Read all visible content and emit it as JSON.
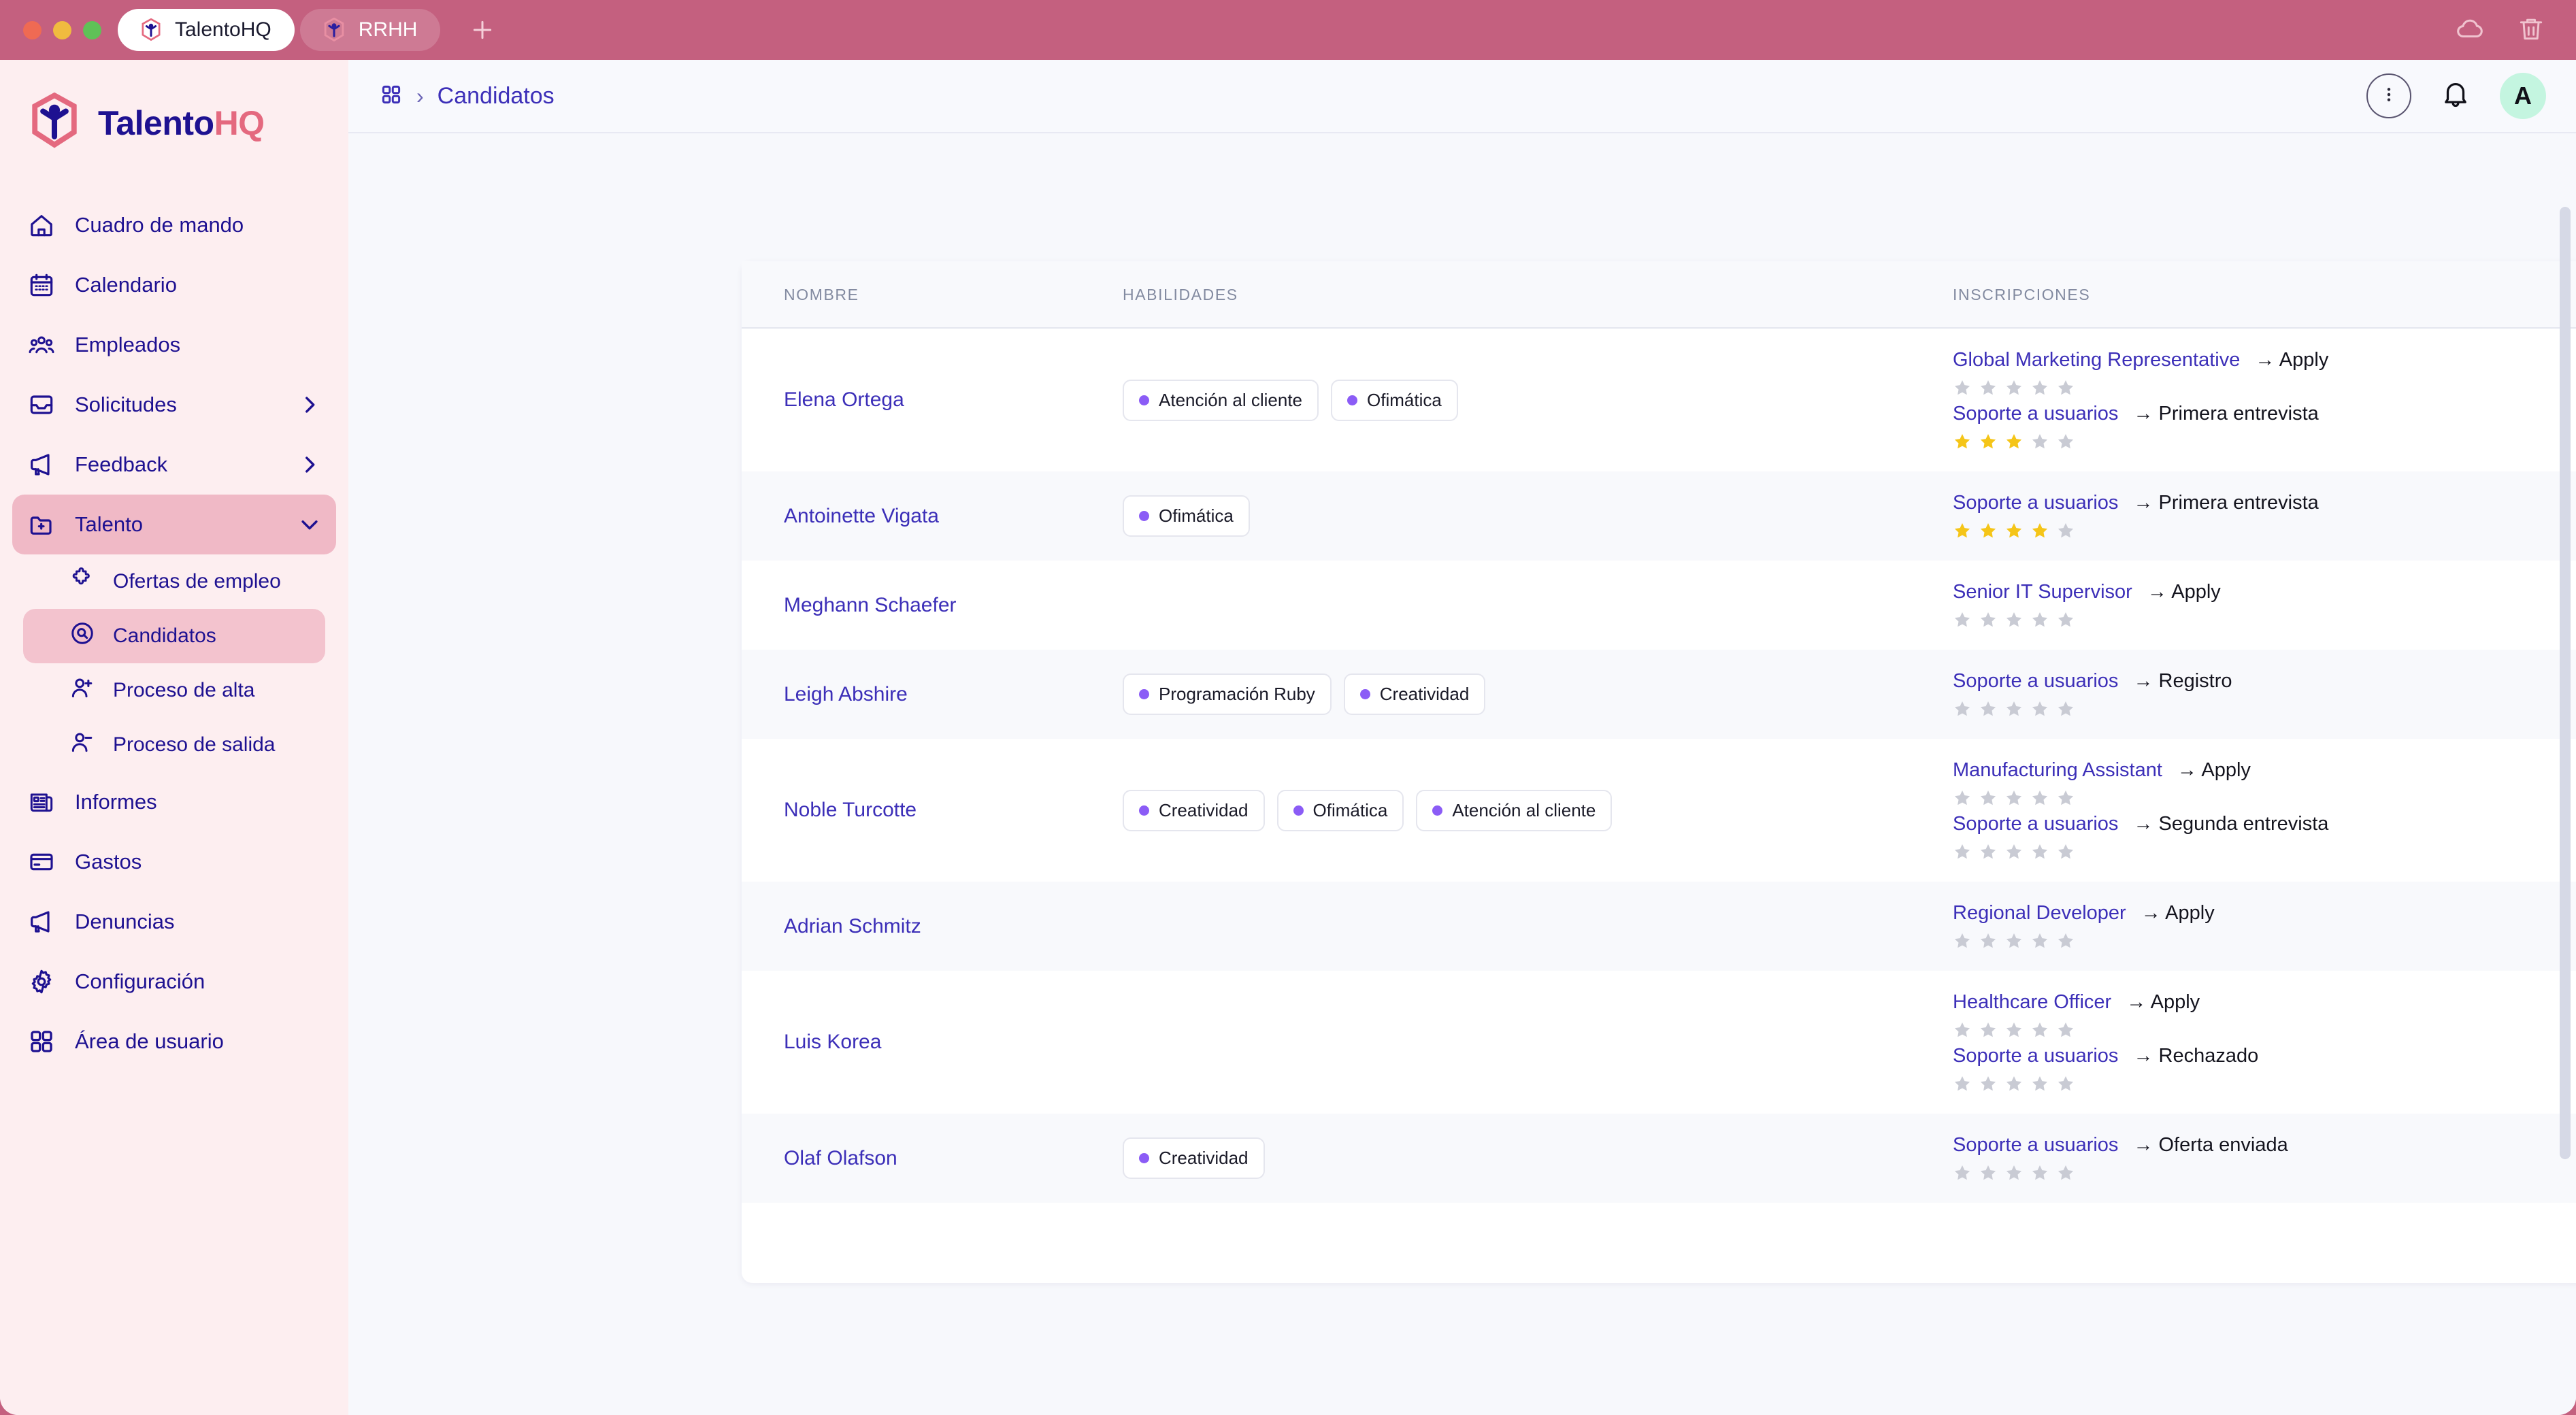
{
  "window": {
    "traffic_lights": [
      "close",
      "minimize",
      "maximize"
    ],
    "tabs": [
      {
        "label": "TalentoHQ",
        "icon": "talento-logo-icon",
        "active": true
      },
      {
        "label": "RRHH",
        "icon": "talento-logo-icon",
        "active": false
      }
    ],
    "new_tab_label": "+",
    "right_icons": [
      "cloud-icon",
      "trash-icon"
    ]
  },
  "sidebar": {
    "logo": {
      "part1": "Talento",
      "part2": "HQ",
      "icon": "talentohq-cube-icon"
    },
    "items": [
      {
        "label": "Cuadro de mando",
        "icon": "home-icon",
        "active": false,
        "expandable": false
      },
      {
        "label": "Calendario",
        "icon": "calendar-icon",
        "active": false,
        "expandable": false
      },
      {
        "label": "Empleados",
        "icon": "people-icon",
        "active": false,
        "expandable": false
      },
      {
        "label": "Solicitudes",
        "icon": "inbox-icon",
        "active": false,
        "expandable": true,
        "expanded": false
      },
      {
        "label": "Feedback",
        "icon": "megaphone-icon",
        "active": false,
        "expandable": true,
        "expanded": false
      },
      {
        "label": "Talento",
        "icon": "folder-plus-icon",
        "active": true,
        "expandable": true,
        "expanded": true
      },
      {
        "label": "Informes",
        "icon": "report-icon",
        "active": false,
        "expandable": false
      },
      {
        "label": "Gastos",
        "icon": "card-icon",
        "active": false,
        "expandable": false
      },
      {
        "label": "Denuncias",
        "icon": "megaphone-icon",
        "active": false,
        "expandable": false
      },
      {
        "label": "Configuración",
        "icon": "gear-icon",
        "active": false,
        "expandable": false
      },
      {
        "label": "Área de usuario",
        "icon": "grid-icon",
        "active": false,
        "expandable": false
      }
    ],
    "talento_subitems": [
      {
        "label": "Ofertas de empleo",
        "icon": "puzzle-icon",
        "active": false
      },
      {
        "label": "Candidatos",
        "icon": "search-circle-icon",
        "active": true
      },
      {
        "label": "Proceso de alta",
        "icon": "user-plus-icon",
        "active": false
      },
      {
        "label": "Proceso de salida",
        "icon": "user-minus-icon",
        "active": false
      }
    ]
  },
  "topbar": {
    "breadcrumb_icon": "grid-icon",
    "breadcrumb_separator": "›",
    "title": "Candidatos",
    "kebab_icon": "more-vertical-icon",
    "bell_icon": "bell-icon",
    "avatar_initial": "A"
  },
  "table": {
    "columns": [
      "NOMBRE",
      "HABILIDADES",
      "INSCRIPCIONES",
      ""
    ],
    "row_menu_icon": "more-vertical-icon",
    "arrow": "→",
    "rows": [
      {
        "name": "Elena Ortega",
        "skills": [
          "Atención al cliente",
          "Ofimática"
        ],
        "enrollments": [
          {
            "job": "Global Marketing Representative",
            "stage": "Apply",
            "rating": 0
          },
          {
            "job": "Soporte a usuarios",
            "stage": "Primera entrevista",
            "rating": 3
          }
        ]
      },
      {
        "name": "Antoinette Vigata",
        "skills": [
          "Ofimática"
        ],
        "enrollments": [
          {
            "job": "Soporte a usuarios",
            "stage": "Primera entrevista",
            "rating": 4
          }
        ]
      },
      {
        "name": "Meghann Schaefer",
        "skills": [],
        "enrollments": [
          {
            "job": "Senior IT Supervisor",
            "stage": "Apply",
            "rating": 0
          }
        ]
      },
      {
        "name": "Leigh Abshire",
        "skills": [
          "Programación Ruby",
          "Creatividad"
        ],
        "enrollments": [
          {
            "job": "Soporte a usuarios",
            "stage": "Registro",
            "rating": 0
          }
        ]
      },
      {
        "name": "Noble Turcotte",
        "skills": [
          "Creatividad",
          "Ofimática",
          "Atención al cliente"
        ],
        "enrollments": [
          {
            "job": "Manufacturing Assistant",
            "stage": "Apply",
            "rating": 0
          },
          {
            "job": "Soporte a usuarios",
            "stage": "Segunda entrevista",
            "rating": 0
          }
        ]
      },
      {
        "name": "Adrian Schmitz",
        "skills": [],
        "enrollments": [
          {
            "job": "Regional Developer",
            "stage": "Apply",
            "rating": 0
          }
        ]
      },
      {
        "name": "Luis Korea",
        "skills": [],
        "enrollments": [
          {
            "job": "Healthcare Officer",
            "stage": "Apply",
            "rating": 0
          },
          {
            "job": "Soporte a usuarios",
            "stage": "Rechazado",
            "rating": 0
          }
        ]
      },
      {
        "name": "Olaf Olafson",
        "skills": [
          "Creatividad"
        ],
        "enrollments": [
          {
            "job": "Soporte a usuarios",
            "stage": "Oferta enviada",
            "rating": 0
          }
        ]
      }
    ]
  },
  "colors": {
    "titlebar": "#c4607f",
    "sidebar_bg": "#fdeef0",
    "sidebar_active": "#f0b9c6",
    "sidebar_sub_active": "#f3c3ce",
    "brand_blue": "#1e1191",
    "brand_pink": "#e4697f",
    "link_blue": "#3c2fb8",
    "badge_dot": "#8b5cf6",
    "star_filled": "#f5c518",
    "star_empty": "#c9cbd4",
    "page_bg": "#f7f8fc",
    "avatar_bg": "#c4f5e0"
  }
}
